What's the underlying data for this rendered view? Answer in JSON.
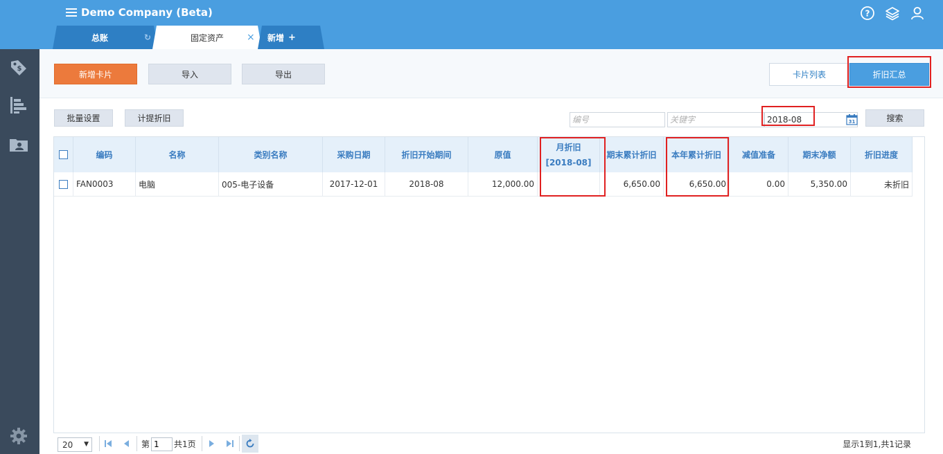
{
  "header": {
    "title": "Demo Company (Beta)",
    "icons": [
      "help-icon",
      "layers-icon",
      "user-icon"
    ]
  },
  "tabs": [
    {
      "label": "总账"
    },
    {
      "label": "固定资产"
    },
    {
      "label": "新增",
      "suffix": "+"
    }
  ],
  "sidebar": {
    "icons": [
      "tag-dollar-icon",
      "bar-list-icon",
      "folder-contact-icon",
      "settings-gear-icon"
    ]
  },
  "toolbar": {
    "add_card": "新增卡片",
    "import": "导入",
    "export": "导出",
    "card_list": "卡片列表",
    "depreciation_summary": "折旧汇总"
  },
  "filters": {
    "batch_settings": "批量设置",
    "accrue_depreciation": "计提折旧",
    "code_placeholder": "编号",
    "keyword_placeholder": "关键字",
    "period_value": "2018-08",
    "search": "搜索"
  },
  "table": {
    "headers": {
      "code": "编码",
      "name": "名称",
      "category": "类别名称",
      "purchase_date": "采购日期",
      "dep_start": "折旧开始期间",
      "original_value": "原值",
      "monthly_dep": "月折旧",
      "monthly_dep_period": "[2018-08]",
      "period_end_acc_dep": "期末累计折旧",
      "year_acc_dep": "本年累计折旧",
      "impairment": "减值准备",
      "net_value": "期末净额",
      "dep_progress": "折旧进度"
    },
    "rows": [
      {
        "code": "FAN0003",
        "name": "电脑",
        "category": "005-电子设备",
        "purchase_date": "2017-12-01",
        "dep_start": "2018-08",
        "original_value": "12,000.00",
        "monthly_dep": "",
        "period_end_acc_dep": "6,650.00",
        "year_acc_dep": "6,650.00",
        "impairment": "0.00",
        "net_value": "5,350.00",
        "dep_progress": "未折旧"
      }
    ]
  },
  "pager": {
    "page_size": "20",
    "page_prefix": "第",
    "page_number": "1",
    "page_total": "共1页",
    "info": "显示1到1,共1记录"
  },
  "colors": {
    "header_blue": "#4a9ee0",
    "tab_dark_blue": "#2e7fc4",
    "sidebar": "#3a4a5c",
    "primary_orange": "#ec7a3c",
    "highlight_red": "#e02020"
  }
}
